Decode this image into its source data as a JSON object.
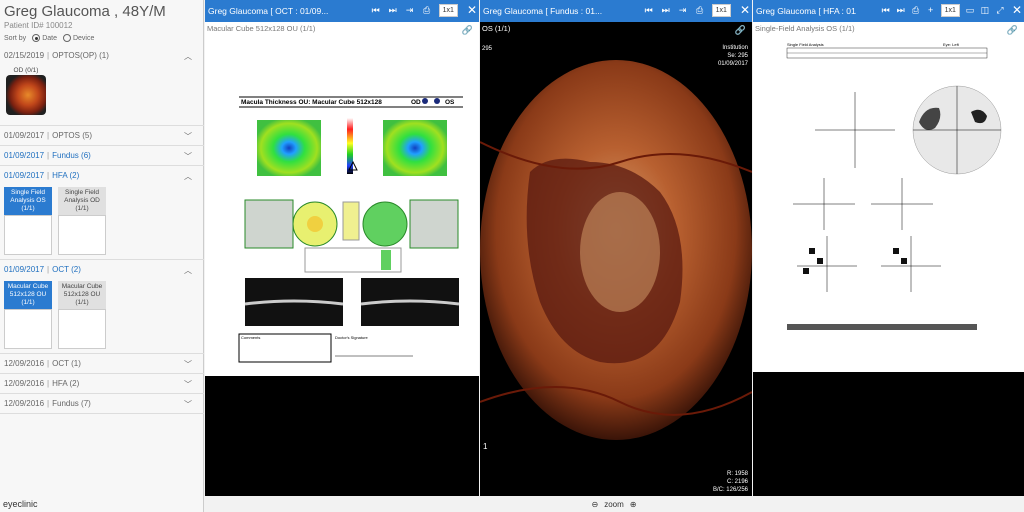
{
  "patient": {
    "name": "Greg Glaucoma , 48Y/M",
    "id": "Patient ID# 100012"
  },
  "sort": {
    "label": "Sort by",
    "option_date": "Date",
    "option_device": "Device"
  },
  "groups": [
    {
      "date": "02/15/2019",
      "name": "OPTOS(OP) (1)",
      "expanded": true,
      "thumb": "OD (0/1)"
    },
    {
      "date": "01/09/2017",
      "name": "OPTOS (5)"
    },
    {
      "date": "01/09/2017",
      "name": "Fundus (6)"
    },
    {
      "date": "01/09/2017",
      "name": "HFA (2)",
      "thumbs": [
        "Single Field Analysis OS (1/1)",
        "Single Field Analysis OD (1/1)"
      ]
    },
    {
      "date": "01/09/2017",
      "name": "OCT (2)",
      "thumbs": [
        "Macular Cube 512x128 OU (1/1)",
        "Macular Cube 512x128 OU (1/1)"
      ]
    },
    {
      "date": "12/09/2016",
      "name": "OCT (1)"
    },
    {
      "date": "12/09/2016",
      "name": "HFA (2)"
    },
    {
      "date": "12/09/2016",
      "name": "Fundus (7)"
    }
  ],
  "panes": {
    "oct": {
      "title": "Greg Glaucoma [ OCT : 01/09...",
      "layout": "1x1",
      "subtitle": "Macular Cube 512x128 OU (1/1)",
      "report_title": "Macula Thickness OU: Macular Cube 512x128",
      "od": "OD",
      "os": "OS",
      "comments": "Comments",
      "signature": "Doctor's Signature"
    },
    "fundus": {
      "title": "Greg Glaucoma [ Fundus : 01...",
      "layout": "1x1",
      "subtitle": "OS (1/1)",
      "num": "295",
      "institution": "Institution",
      "se": "Se: 295",
      "date": "01/09/2017",
      "r": "R: 1958",
      "c": "C: 2196",
      "bc": "B/C: 126/256",
      "frame": "1"
    },
    "hfa": {
      "title": "Greg Glaucoma [ HFA : 01/05...",
      "layout": "1x1",
      "subtitle": "Single-Field Analysis OS (1/1)",
      "report_header": "Single Field Analysis",
      "eye": "Eye: Left"
    }
  },
  "footer": {
    "zoom": "zoom",
    "logo": "eyeclinic"
  }
}
